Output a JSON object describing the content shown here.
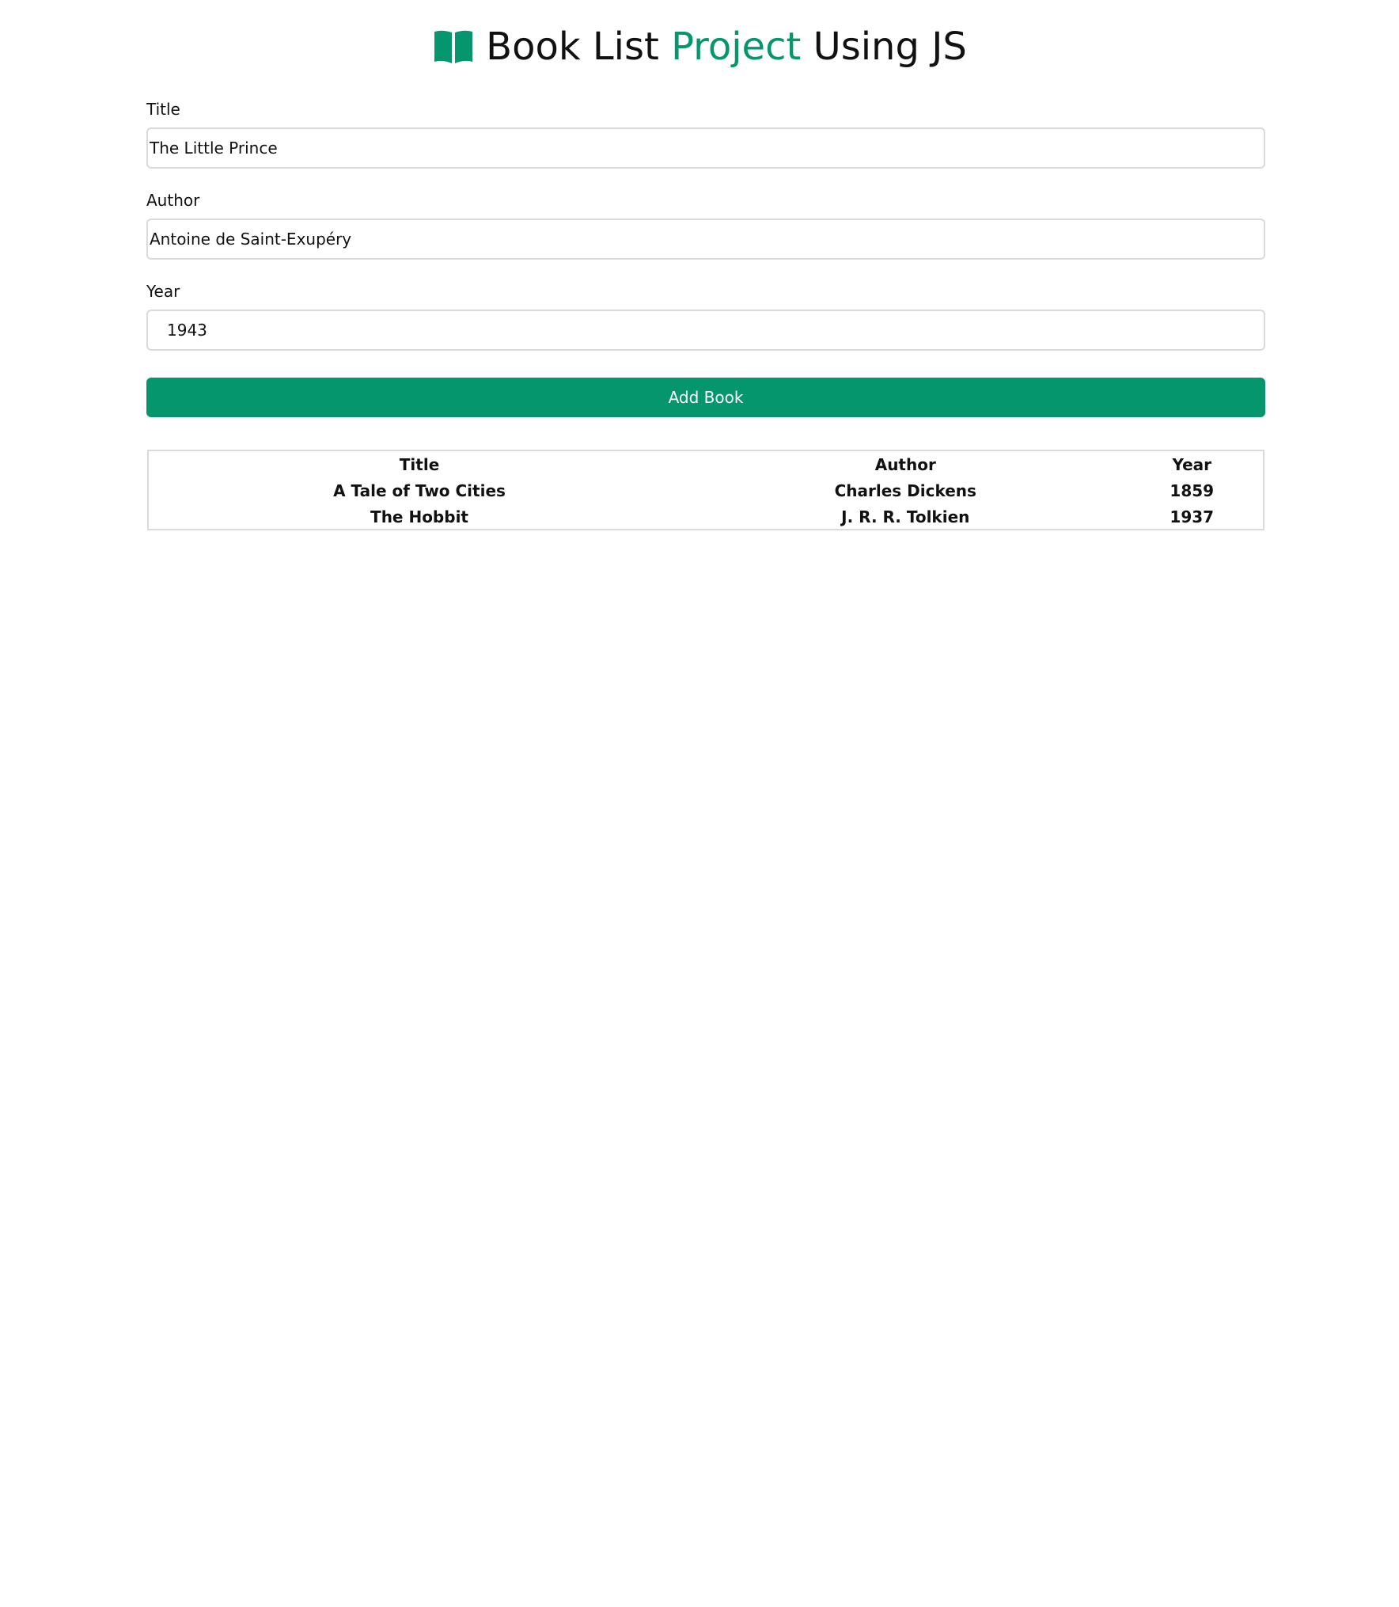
{
  "header": {
    "icon": "open-book-icon",
    "title_part1": "Book List",
    "title_accent": "Project",
    "title_part2": "Using JS"
  },
  "colors": {
    "accent": "#05966d",
    "input_border": "#dadada",
    "text": "#111111",
    "button_text": "#ffffff"
  },
  "form": {
    "title_label": "Title",
    "title_value": "The Little Prince",
    "author_label": "Author",
    "author_value": "Antoine de Saint-Exupéry",
    "year_label": "Year",
    "year_value": "1943",
    "add_button_label": "Add Book"
  },
  "table": {
    "headers": [
      "Title",
      "Author",
      "Year"
    ],
    "rows": [
      [
        "A Tale of Two Cities",
        "Charles Dickens",
        "1859"
      ],
      [
        "The Hobbit",
        "J. R. R. Tolkien",
        "1937"
      ]
    ]
  }
}
